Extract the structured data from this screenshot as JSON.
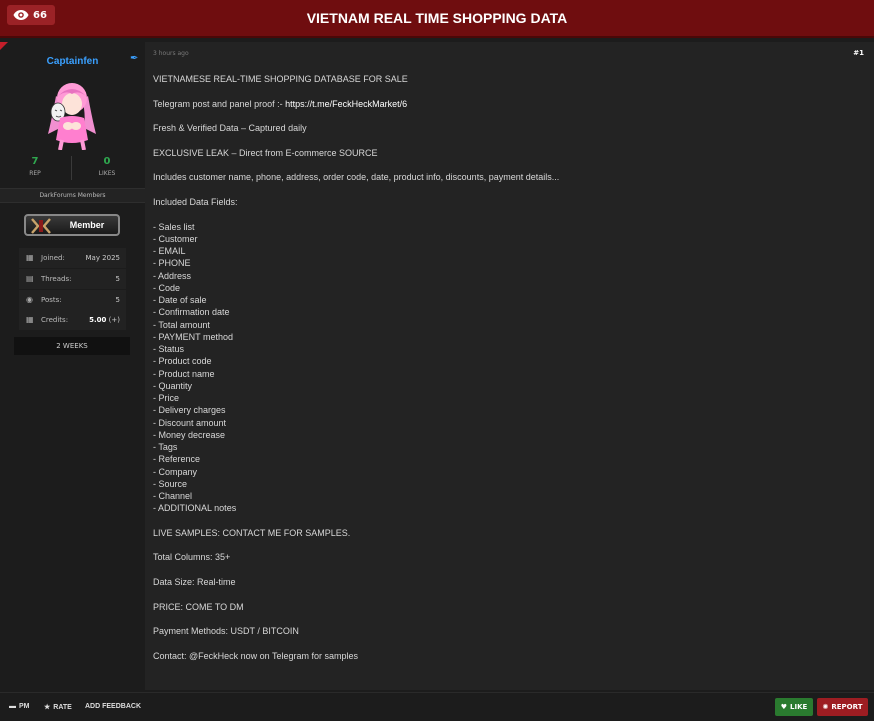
{
  "header": {
    "views": "66",
    "title": "VIETNAM REAL TIME SHOPPING DATA"
  },
  "user": {
    "name": "Captainfen",
    "rep_value": "7",
    "rep_label": "REP",
    "likes_value": "0",
    "likes_label": "LIKES",
    "group": "DarkForums Members",
    "rank": "Member",
    "info": [
      {
        "key": "Joined:",
        "value": "May 2025"
      },
      {
        "key": "Threads:",
        "value": "5"
      },
      {
        "key": "Posts:",
        "value": "5"
      },
      {
        "key": "Credits:",
        "value": "5.00",
        "extra": "(+)"
      }
    ],
    "duration": "2 WEEKS"
  },
  "post": {
    "time": "3 hours ago",
    "number": "#1",
    "lines": {
      "intro": "VIETNAMESE REAL-TIME SHOPPING DATABASE FOR SALE",
      "telegram_prefix": "Telegram post and panel proof :- ",
      "telegram_link": "https://t.me/FeckHeckMarket/6",
      "fresh": "Fresh & Verified Data – Captured daily",
      "exclusive": "EXCLUSIVE LEAK – Direct from E-commerce SOURCE",
      "includes": "Includes customer name, phone, address, order code, date, product info, discounts, payment details...",
      "fields_title": "Included Data Fields:",
      "fields": [
        "- Sales list",
        "- Customer",
        "- EMAIL",
        "- PHONE",
        "- Address",
        "- Code",
        "- Date of sale",
        "- Confirmation date",
        "- Total amount",
        "- PAYMENT method",
        "- Status",
        "- Product code",
        "- Product name",
        "- Quantity",
        "- Price",
        "- Delivery charges",
        "- Discount amount",
        "- Money decrease",
        "- Tags",
        "- Reference",
        "- Company",
        "- Source",
        "- Channel",
        "- ADDITIONAL notes"
      ],
      "samples": "LIVE SAMPLES: CONTACT ME FOR SAMPLES.",
      "columns": "Total Columns: 35+",
      "size": "Data Size: Real-time",
      "price": "PRICE: COME TO DM",
      "payment": "Payment Methods: USDT / BITCOIN",
      "contact": "Contact: @FeckHeck now on Telegram for samples"
    }
  },
  "footer": {
    "pm": "PM",
    "rate": "RATE",
    "feedback": "ADD FEEDBACK",
    "like": "LIKE",
    "report": "REPORT"
  },
  "colors": {
    "header": "#6f0d0f",
    "username": "#3aa0ff",
    "like": "#2a7a2f",
    "report": "#9d1d22"
  }
}
